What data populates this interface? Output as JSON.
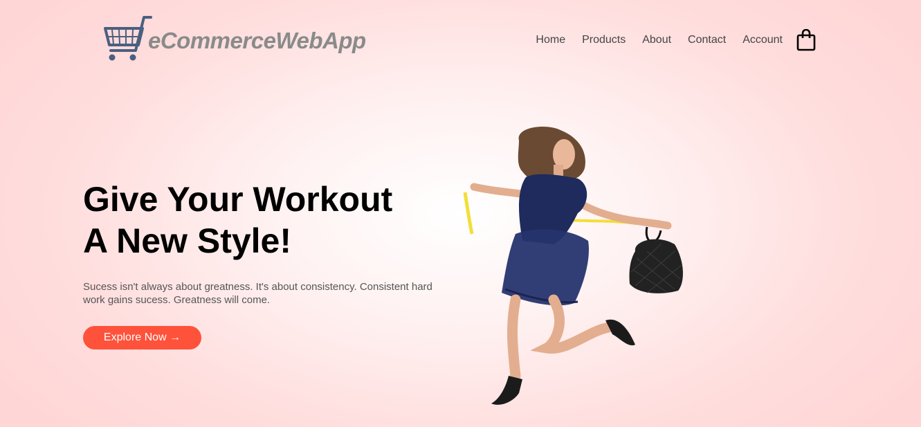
{
  "brand": {
    "name": "eCommerceWebApp",
    "logo_icon": "shopping-cart-icon",
    "logo_color": "#4a5f7f"
  },
  "nav": {
    "items": [
      {
        "label": "Home"
      },
      {
        "label": "Products"
      },
      {
        "label": "About"
      },
      {
        "label": "Contact"
      },
      {
        "label": "Account"
      }
    ],
    "cart_icon": "shopping-bag-icon"
  },
  "hero": {
    "title_line1": "Give Your Workout",
    "title_line2": "A New Style!",
    "description": "Sucess isn't always about greatness. It's about consistency. Consistent hard work gains sucess. Greatness will come.",
    "cta_label": "Explore Now →",
    "cta_color": "#ff523b",
    "image_alt_icon": "model-with-handbag-image"
  },
  "colors": {
    "background": "#ffd6d6",
    "text_dark": "#000000",
    "text_muted": "#555555"
  }
}
